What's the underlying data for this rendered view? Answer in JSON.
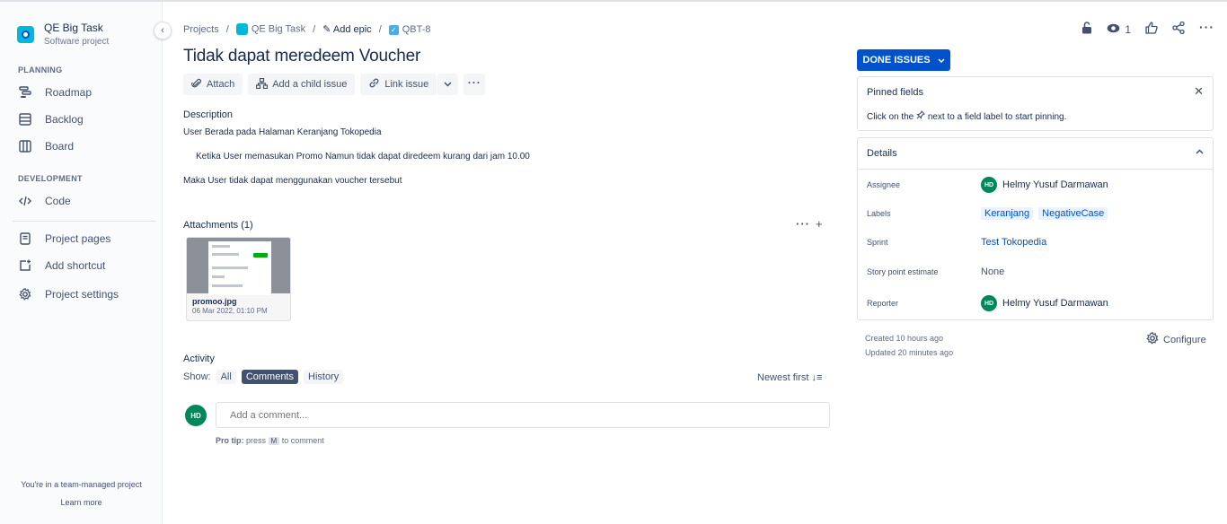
{
  "sidebar": {
    "project_name": "QE Big Task",
    "project_type": "Software project",
    "planning_heading": "PLANNING",
    "development_heading": "DEVELOPMENT",
    "items": [
      {
        "label": "Roadmap",
        "icon": "roadmap-icon"
      },
      {
        "label": "Backlog",
        "icon": "backlog-icon"
      },
      {
        "label": "Board",
        "icon": "board-icon"
      },
      {
        "label": "Code",
        "icon": "code-icon"
      },
      {
        "label": "Project pages",
        "icon": "pages-icon"
      },
      {
        "label": "Add shortcut",
        "icon": "add-shortcut-icon"
      },
      {
        "label": "Project settings",
        "icon": "gear-icon"
      }
    ],
    "footer_text": "You're in a team-managed project",
    "footer_link": "Learn more"
  },
  "breadcrumb": {
    "projects": "Projects",
    "project": "QE Big Task",
    "epic": "Add epic",
    "issue_key": "QBT-8"
  },
  "issue": {
    "title": "Tidak dapat meredeem Voucher",
    "toolbar": {
      "attach": "Attach",
      "add_child": "Add a child issue",
      "link_issue": "Link issue"
    },
    "description_label": "Description",
    "description_lines": [
      "User Berada pada Halaman Keranjang Tokopedia",
      "Ketika User memasukan Promo Namun tidak dapat diredeem kurang dari jam 10.00",
      "Maka User tidak dapat menggunakan voucher tersebut"
    ],
    "attachments_label": "Attachments (1)",
    "attachment": {
      "filename": "promoo.jpg",
      "date": "06 Mar 2022, 01:10 PM"
    }
  },
  "activity": {
    "label": "Activity",
    "show_label": "Show:",
    "filters": [
      "All",
      "Comments",
      "History"
    ],
    "active_filter": "Comments",
    "sort": "Newest first",
    "comment_avatar": "HD",
    "comment_placeholder": "Add a comment...",
    "protip_prefix": "Pro tip:",
    "protip_press": "press",
    "protip_key": "M",
    "protip_suffix": "to comment"
  },
  "top_actions": {
    "watch_count": "1"
  },
  "status": {
    "label": "DONE ISSUES",
    "color": "#0052cc"
  },
  "pinned": {
    "title": "Pinned fields",
    "hint_before": "Click on the",
    "hint_after": "next to a field label to start pinning."
  },
  "details": {
    "title": "Details",
    "assignee_label": "Assignee",
    "assignee": "Helmy Yusuf Darmawan",
    "assignee_initials": "HD",
    "labels_label": "Labels",
    "labels": [
      "Keranjang",
      "NegativeCase"
    ],
    "sprint_label": "Sprint",
    "sprint": "Test Tokopedia",
    "story_points_label": "Story point estimate",
    "story_points": "None",
    "reporter_label": "Reporter",
    "reporter": "Helmy Yusuf Darmawan",
    "reporter_initials": "HD"
  },
  "meta": {
    "created": "Created 10 hours ago",
    "updated": "Updated 20 minutes ago",
    "configure": "Configure"
  }
}
